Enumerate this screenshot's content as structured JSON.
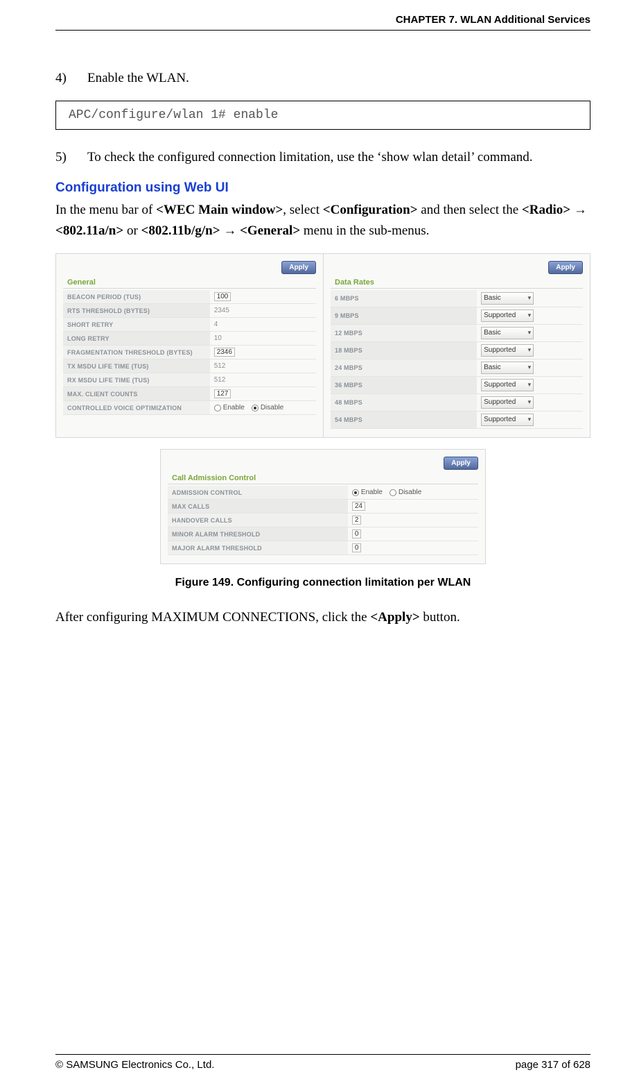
{
  "header": {
    "chapter": "CHAPTER 7. WLAN Additional Services"
  },
  "steps": {
    "s4": {
      "num": "4)",
      "text": "Enable the WLAN."
    },
    "s5": {
      "num": "5)",
      "text": "To check the configured connection limitation, use the ‘show wlan detail’ command."
    }
  },
  "code": {
    "line1": "APC/configure/wlan 1# enable"
  },
  "section": {
    "heading": "Configuration using Web UI",
    "para_pre": "In the menu bar of ",
    "wec": "<WEC Main window>",
    "para_mid1": ", select ",
    "config": "<Configuration>",
    "para_mid2": " and then select the ",
    "radio": "<Radio>",
    "arrow": " → ",
    "a802a": "<802.11a/n>",
    "or": " or ",
    "a802b": "<802.11b/g/n>",
    "general": "<General>",
    "para_end": " menu in the sub-menus."
  },
  "figure": {
    "apply": "Apply",
    "general": {
      "title": "General",
      "rows": [
        {
          "label": "BEACON PERIOD (TUS)",
          "value": "100",
          "type": "input"
        },
        {
          "label": "RTS THRESHOLD (BYTES)",
          "value": "2345",
          "type": "text"
        },
        {
          "label": "SHORT RETRY",
          "value": "4",
          "type": "text"
        },
        {
          "label": "LONG RETRY",
          "value": "10",
          "type": "text"
        },
        {
          "label": "FRAGMENTATION THRESHOLD (BYTES)",
          "value": "2346",
          "type": "input"
        },
        {
          "label": "TX MSDU LIFE TIME (TUS)",
          "value": "512",
          "type": "text"
        },
        {
          "label": "RX MSDU LIFE TIME (TUS)",
          "value": "512",
          "type": "text"
        },
        {
          "label": "MAX. CLIENT COUNTS",
          "value": "127",
          "type": "input"
        },
        {
          "label": "CONTROLLED VOICE OPTIMIZATION",
          "value": "Disable",
          "type": "radio",
          "enable": "Enable",
          "disable": "Disable"
        }
      ]
    },
    "rates": {
      "title": "Data Rates",
      "rows": [
        {
          "label": "6 MBPS",
          "value": "Basic"
        },
        {
          "label": "9 MBPS",
          "value": "Supported"
        },
        {
          "label": "12 MBPS",
          "value": "Basic"
        },
        {
          "label": "18 MBPS",
          "value": "Supported"
        },
        {
          "label": "24 MBPS",
          "value": "Basic"
        },
        {
          "label": "36 MBPS",
          "value": "Supported"
        },
        {
          "label": "48 MBPS",
          "value": "Supported"
        },
        {
          "label": "54 MBPS",
          "value": "Supported"
        }
      ]
    },
    "cac": {
      "title": "Call Admission Control",
      "rows": [
        {
          "label": "ADMISSION CONTROL",
          "type": "radio",
          "enable": "Enable",
          "disable": "Disable",
          "value": "Enable"
        },
        {
          "label": "MAX CALLS",
          "type": "input",
          "value": "24"
        },
        {
          "label": "HANDOVER CALLS",
          "type": "input",
          "value": "2"
        },
        {
          "label": "MINOR ALARM THRESHOLD",
          "type": "input",
          "value": "0"
        },
        {
          "label": "MAJOR ALARM THRESHOLD",
          "type": "input",
          "value": "0"
        }
      ]
    },
    "caption": "Figure 149. Configuring connection limitation per WLAN"
  },
  "after_para": {
    "pre": "After configuring MAXIMUM CONNECTIONS, click the ",
    "apply": "<Apply>",
    "post": " button."
  },
  "footer": {
    "copyright": "© SAMSUNG Electronics Co., Ltd.",
    "page": "page 317 of 628"
  }
}
